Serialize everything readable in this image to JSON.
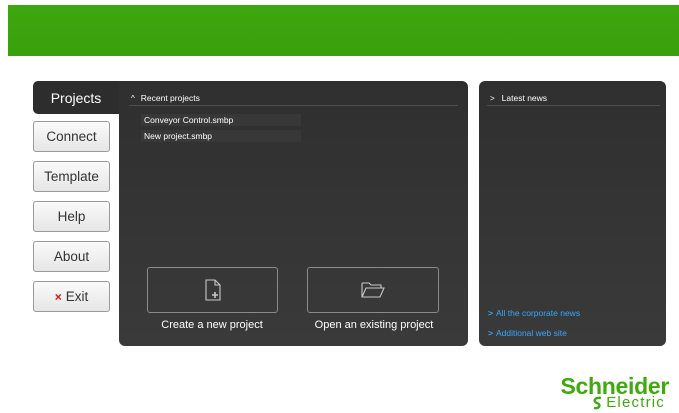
{
  "nav": {
    "projects": "Projects",
    "connect": "Connect",
    "template": "Template",
    "help": "Help",
    "about": "About",
    "exit": "Exit",
    "exit_icon": "×"
  },
  "recent": {
    "header": "Recent projects",
    "header_icon": "^",
    "items": [
      {
        "label": "Conveyor Control.smbp"
      },
      {
        "label": "New project.smbp"
      }
    ],
    "create_label": "Create a new project",
    "open_label": "Open an existing project"
  },
  "news": {
    "header": "Latest news",
    "header_icon": ">",
    "links": [
      {
        "label": "All the corporate news"
      },
      {
        "label": "Additional web site"
      }
    ]
  },
  "brand": {
    "line1": "Schneider",
    "line2": "Electric",
    "color": "#3dab0c"
  },
  "colors": {
    "topbar": "#3ea60f",
    "panel": "#333333",
    "link": "#35a8ff"
  }
}
